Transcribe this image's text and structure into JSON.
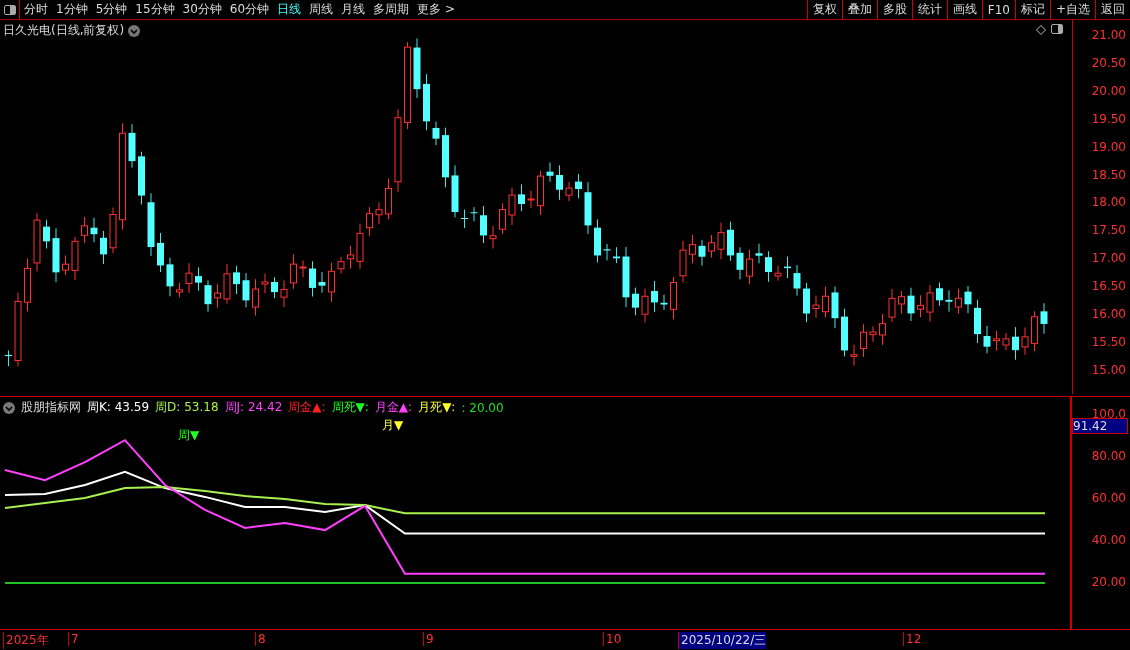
{
  "toolbar": {
    "periods": [
      {
        "label": "分时",
        "selected": false
      },
      {
        "label": "1分钟",
        "selected": false
      },
      {
        "label": "5分钟",
        "selected": false
      },
      {
        "label": "15分钟",
        "selected": false
      },
      {
        "label": "30分钟",
        "selected": false
      },
      {
        "label": "60分钟",
        "selected": false
      },
      {
        "label": "日线",
        "selected": true
      },
      {
        "label": "周线",
        "selected": false
      },
      {
        "label": "月线",
        "selected": false
      },
      {
        "label": "多周期",
        "selected": false
      },
      {
        "label": "更多 >",
        "selected": false
      }
    ],
    "buttons": [
      "复权",
      "叠加",
      "多股",
      "统计",
      "画线",
      "F10",
      "标记",
      "+自选",
      "返回"
    ]
  },
  "price_panel": {
    "title": "日久光电(日线,前复权)",
    "axis_labels": [
      "21.00",
      "20.50",
      "20.00",
      "19.50",
      "19.00",
      "18.50",
      "18.00",
      "17.50",
      "17.00",
      "16.50",
      "16.00",
      "15.50",
      "15.00"
    ]
  },
  "indicator": {
    "name": "股朋指标网",
    "legend_values": [
      ": 43.59",
      ": 53.18",
      ": 24.42"
    ],
    "legend": [
      {
        "text": "周金▲:",
        "color": "#ff2020"
      },
      {
        "text": "周死▼:",
        "color": "#20ff20"
      },
      {
        "text": "月金▲:",
        "color": "#ff40ff"
      },
      {
        "text": "月死▼:",
        "color": "#ffff30"
      },
      {
        "text": ": 20.00",
        "color": "#20e020"
      }
    ],
    "value_badge": "91.42",
    "markers": [
      {
        "text": "周▼",
        "color": "#20ff20"
      },
      {
        "text": "月▼",
        "color": "#ffff30"
      }
    ],
    "chart_data": {
      "type": "line",
      "ylim": [
        -2.4,
        108.6
      ],
      "yticks": [
        {
          "value": 100,
          "label": "100.0"
        },
        {
          "value": 80,
          "label": "80.00"
        },
        {
          "value": 60,
          "label": "60.00"
        },
        {
          "value": 40,
          "label": "40.00"
        },
        {
          "value": 20,
          "label": "20.00"
        }
      ],
      "series": [
        {
          "name": "周K",
          "color": "#ffffff",
          "values": [
            61.9,
            62.4,
            66.7,
            72.9,
            65.2,
            61,
            56.2,
            56.2,
            53.8,
            57.1,
            43.59,
            43.59,
            43.59,
            43.59,
            43.59,
            43.59,
            43.59,
            43.59,
            43.59,
            43.59,
            43.59,
            43.59,
            43.59,
            43.59,
            43.59,
            43.59,
            43.59
          ]
        },
        {
          "name": "周D",
          "color": "#a8f050",
          "values": [
            55.7,
            58.1,
            60.5,
            65.2,
            65.7,
            63.8,
            61.4,
            60,
            57.6,
            57.1,
            53.18,
            53.18,
            53.18,
            53.18,
            53.18,
            53.18,
            53.18,
            53.18,
            53.18,
            53.18,
            53.18,
            53.18,
            53.18,
            53.18,
            53.18,
            53.18,
            53.18
          ]
        },
        {
          "name": "周J",
          "color": "#ff40ff",
          "values": [
            73.8,
            69,
            77.6,
            88,
            66.7,
            54.8,
            46.2,
            48.6,
            45.2,
            56.7,
            24.42,
            24.42,
            24.42,
            24.42,
            24.42,
            24.42,
            24.42,
            24.42,
            24.42,
            24.42,
            24.42,
            24.42,
            24.42,
            24.42,
            24.42,
            24.42,
            24.42
          ]
        },
        {
          "color": "#20c020",
          "values": [
            20,
            20,
            20,
            20,
            20,
            20,
            20,
            20,
            20,
            20,
            20,
            20,
            20,
            20,
            20,
            20,
            20,
            20,
            20,
            20,
            20,
            20,
            20,
            20,
            20,
            20,
            20
          ]
        }
      ]
    }
  },
  "time_axis": {
    "labels": [
      {
        "text": "2025年",
        "selected": false
      },
      {
        "text": "7",
        "selected": false
      },
      {
        "text": "8",
        "selected": false
      },
      {
        "text": "9",
        "selected": false
      },
      {
        "text": "10",
        "selected": false
      },
      {
        "text": "2025/10/22/三",
        "selected": true
      },
      {
        "text": "12",
        "selected": false
      }
    ]
  }
}
